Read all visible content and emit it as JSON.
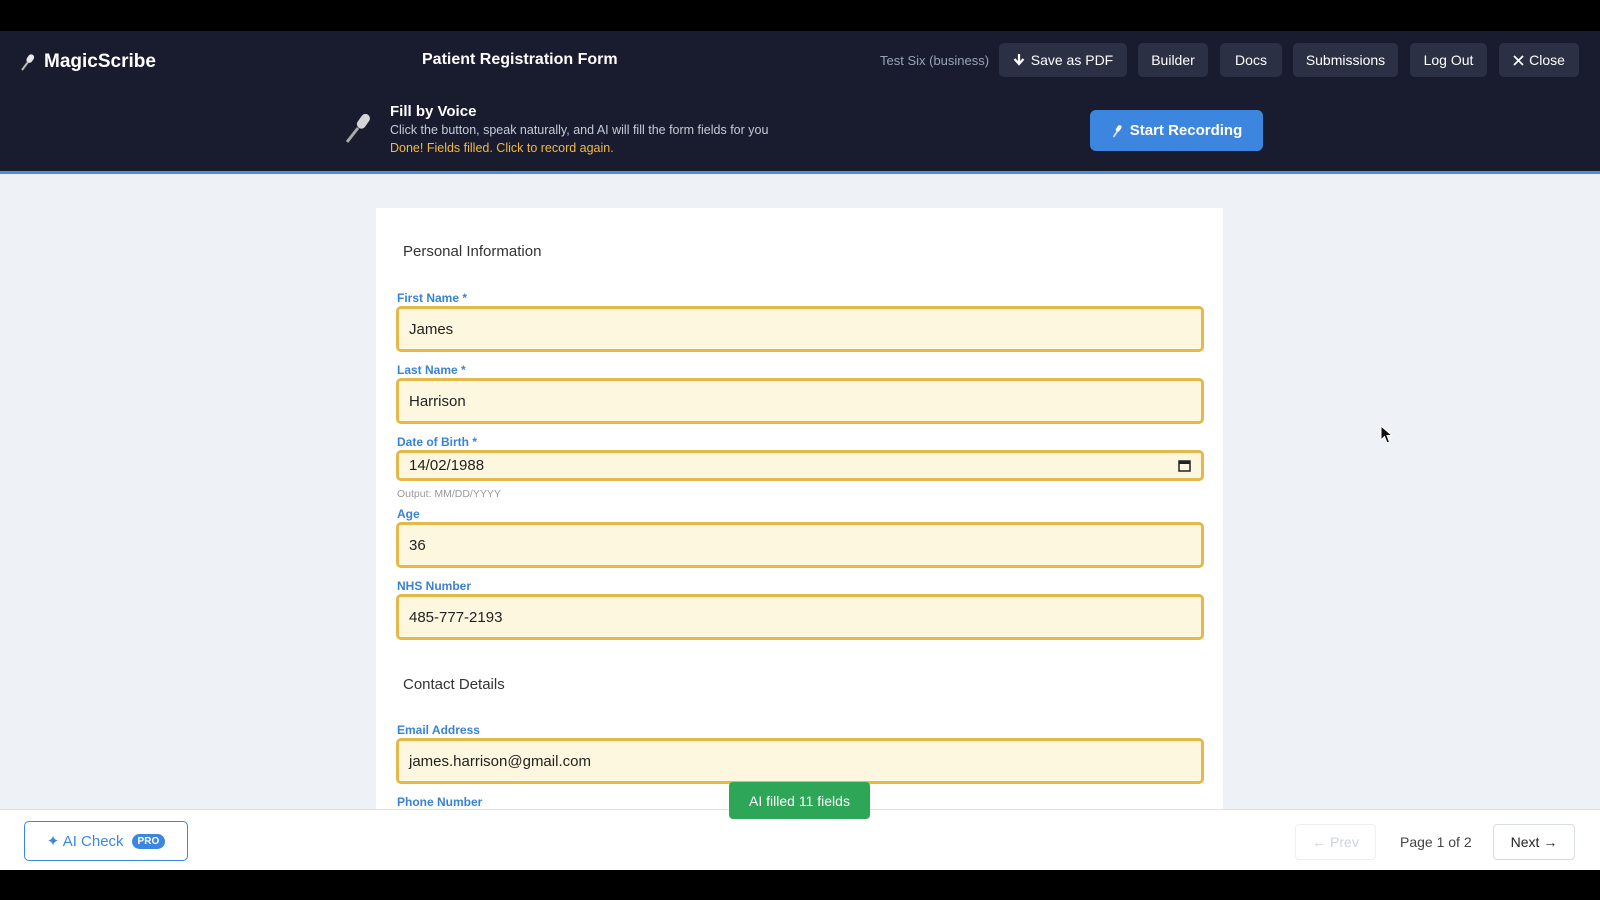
{
  "header": {
    "brand": "MagicScribe",
    "form_title": "Patient Registration Form",
    "user": "Test Six (business)",
    "buttons": {
      "save_pdf": "Save as PDF",
      "builder": "Builder",
      "docs": "Docs",
      "submissions": "Submissions",
      "logout": "Log Out",
      "close": "Close"
    }
  },
  "voice": {
    "title": "Fill by Voice",
    "description": "Click the button, speak naturally, and AI will fill the form fields for you",
    "status": "Done! Fields filled. Click to record again.",
    "record_button": "Start Recording"
  },
  "form": {
    "sections": {
      "personal": "Personal Information",
      "contact": "Contact Details"
    },
    "fields": {
      "first_name": {
        "label": "First Name *",
        "value": "James"
      },
      "last_name": {
        "label": "Last Name *",
        "value": "Harrison"
      },
      "dob": {
        "label": "Date of Birth *",
        "value": "14/02/1988",
        "hint": "Output: MM/DD/YYYY"
      },
      "age": {
        "label": "Age",
        "value": "36"
      },
      "nhs": {
        "label": "NHS Number",
        "value": "485-777-2193"
      },
      "email": {
        "label": "Email Address",
        "value": "james.harrison@gmail.com"
      },
      "phone": {
        "label": "Phone Number"
      }
    }
  },
  "toast": "AI filled 11 fields",
  "footer": {
    "ai_check": "✦ AI Check",
    "pro_badge": "PRO",
    "prev": "← Prev",
    "page_indicator": "Page 1 of 2",
    "next": "Next →"
  },
  "colors": {
    "header_bg": "#181c2e",
    "accent": "#3d86e0",
    "field_border": "#e2b94a",
    "field_bg": "#fdf7e0",
    "status_text": "#f4b942",
    "toast_bg": "#2ea657"
  },
  "icons": {
    "brand": "microphone-icon",
    "voice": "microphone-icon",
    "save": "download-arrow-icon",
    "close": "x-icon",
    "calendar": "calendar-icon"
  }
}
